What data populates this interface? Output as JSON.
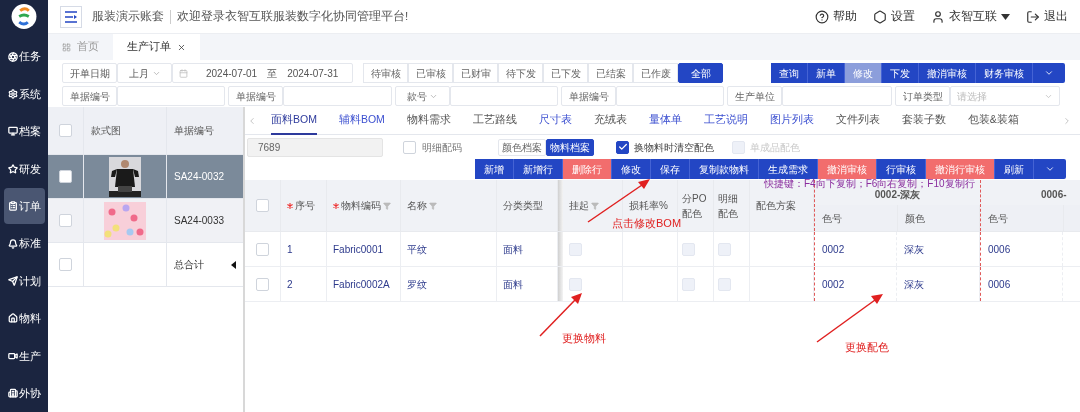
{
  "sidebar": {
    "items": [
      {
        "label": "任务",
        "selected": false
      },
      {
        "label": "系统",
        "selected": false
      },
      {
        "label": "档案",
        "selected": false
      },
      {
        "label": "研发",
        "selected": false
      },
      {
        "label": "订单",
        "selected": true
      },
      {
        "label": "标准",
        "selected": false
      },
      {
        "label": "计划",
        "selected": false
      },
      {
        "label": "物料",
        "selected": false
      },
      {
        "label": "生产",
        "selected": false
      },
      {
        "label": "外协",
        "selected": false
      }
    ]
  },
  "header": {
    "account": "服装演示账套",
    "welcome": "欢迎登录衣智互联服装数字化协同管理平台!",
    "help": "帮助",
    "settings": "设置",
    "user": "衣智互联",
    "logout": "退出"
  },
  "tabs": [
    {
      "label": "首页",
      "selected": false,
      "closable": false
    },
    {
      "label": "生产订单",
      "selected": true,
      "closable": true
    }
  ],
  "filters": {
    "date_field": "开单日期",
    "period": "上月",
    "date_from": "2024-07-01",
    "date_sep": "至",
    "date_to": "2024-07-31",
    "status": [
      {
        "label": "待审核",
        "selected": false
      },
      {
        "label": "已审核",
        "selected": false
      },
      {
        "label": "已财审",
        "selected": false
      },
      {
        "label": "待下发",
        "selected": false
      },
      {
        "label": "已下发",
        "selected": false
      },
      {
        "label": "已结案",
        "selected": false
      },
      {
        "label": "已作废",
        "selected": false
      },
      {
        "label": "全部",
        "selected": true
      }
    ],
    "actions": [
      {
        "label": "查询",
        "disabled": false
      },
      {
        "label": "新单",
        "disabled": false
      },
      {
        "label": "修改",
        "disabled": true
      },
      {
        "label": "下发",
        "disabled": false
      },
      {
        "label": "撤消审核",
        "disabled": false
      },
      {
        "label": "财务审核",
        "disabled": false
      }
    ],
    "fields": [
      {
        "label": "单据编号",
        "kind": "text"
      },
      {
        "label": "单据编号",
        "kind": "text"
      },
      {
        "label": "款号",
        "kind": "dropdown"
      },
      {
        "label": "单据编号",
        "kind": "text"
      },
      {
        "label": "生产单位",
        "kind": "text"
      },
      {
        "label": "订单类型",
        "kind": "select",
        "placeholder": "请选择"
      }
    ]
  },
  "orders": {
    "select_all_checked": false,
    "columns": [
      "款式图",
      "单据编号"
    ],
    "rows": [
      {
        "code": "SA24-0032",
        "selected": true,
        "checked": false
      },
      {
        "code": "SA24-0033",
        "selected": false,
        "checked": false
      }
    ],
    "total": "总合计",
    "total_checked": false
  },
  "bom": {
    "tabs": [
      {
        "label": "面料BOM",
        "selected": true,
        "has_data": true
      },
      {
        "label": "辅料BOM",
        "selected": false,
        "has_data": true
      },
      {
        "label": "物料需求",
        "selected": false,
        "has_data": false
      },
      {
        "label": "工艺路线",
        "selected": false,
        "has_data": false
      },
      {
        "label": "尺寸表",
        "selected": false,
        "has_data": true
      },
      {
        "label": "充绒表",
        "selected": false,
        "has_data": false
      },
      {
        "label": "量体单",
        "selected": false,
        "has_data": true
      },
      {
        "label": "工艺说明",
        "selected": false,
        "has_data": true
      },
      {
        "label": "图片列表",
        "selected": false,
        "has_data": true
      },
      {
        "label": "文件列表",
        "selected": false,
        "has_data": false
      },
      {
        "label": "套装子数",
        "selected": false,
        "has_data": false
      },
      {
        "label": "包装&装箱",
        "selected": false,
        "has_data": false
      }
    ],
    "select_all_checked": false,
    "search_value": "7689",
    "detail_size": {
      "label": "明细配码",
      "checked": false
    },
    "archive": [
      {
        "label": "颜色档案",
        "selected": false
      },
      {
        "label": "物料档案",
        "selected": true
      }
    ],
    "clear_color": {
      "label": "换物料时清空配色",
      "checked": true
    },
    "single_color": {
      "label": "单成品配色",
      "checked": false,
      "disabled": true
    },
    "actions": [
      {
        "label": "新增",
        "kind": "primary"
      },
      {
        "label": "新增行",
        "kind": "primary"
      },
      {
        "label": "删除行",
        "kind": "danger"
      },
      {
        "label": "修改",
        "kind": "primary"
      },
      {
        "label": "保存",
        "kind": "primary"
      },
      {
        "label": "复制款物料",
        "kind": "primary"
      },
      {
        "label": "生成需求",
        "kind": "primary"
      },
      {
        "label": "撤消审核",
        "kind": "danger"
      },
      {
        "label": "行审核",
        "kind": "primary"
      },
      {
        "label": "撤消行审核",
        "kind": "danger"
      },
      {
        "label": "刷新",
        "kind": "primary"
      }
    ],
    "hint": "快捷键：F4向下复制；F6向右复制；F10复制行",
    "columns": [
      {
        "label": "序号",
        "required": true,
        "filter": false
      },
      {
        "label": "物料编码",
        "required": true,
        "filter": true
      },
      {
        "label": "名称",
        "required": false,
        "filter": true
      },
      {
        "label": "分类类型",
        "required": false,
        "filter": false
      },
      {
        "label": "挂起",
        "required": false,
        "filter": true
      },
      {
        "label": "损耗率%",
        "required": false,
        "filter": false
      },
      {
        "label": "分PO配色",
        "required": false,
        "filter": false
      },
      {
        "label": "明细配色",
        "required": false,
        "filter": false
      },
      {
        "label": "配色方案",
        "required": false,
        "filter": false
      }
    ],
    "color_groups": [
      {
        "label": "0002-深灰",
        "columns": [
          "色号",
          "颜色"
        ]
      },
      {
        "label": "0006-",
        "columns": [
          "色号"
        ]
      }
    ],
    "rows": [
      {
        "selected": false,
        "no": "1",
        "code": "Fabric0001",
        "name": "平纹",
        "category": "面料",
        "suspended": false,
        "split_po": false,
        "detail_color": false,
        "colors": [
          "0002",
          "深灰",
          "0006"
        ]
      },
      {
        "selected": false,
        "no": "2",
        "code": "Fabric0002A",
        "name": "罗纹",
        "category": "面料",
        "suspended": false,
        "split_po": false,
        "detail_color": false,
        "colors": [
          "0002",
          "深灰",
          "0006"
        ]
      }
    ]
  },
  "annotations": [
    {
      "text": "点击修改BOM"
    },
    {
      "text": "更换物料"
    },
    {
      "text": "更换配色"
    }
  ]
}
